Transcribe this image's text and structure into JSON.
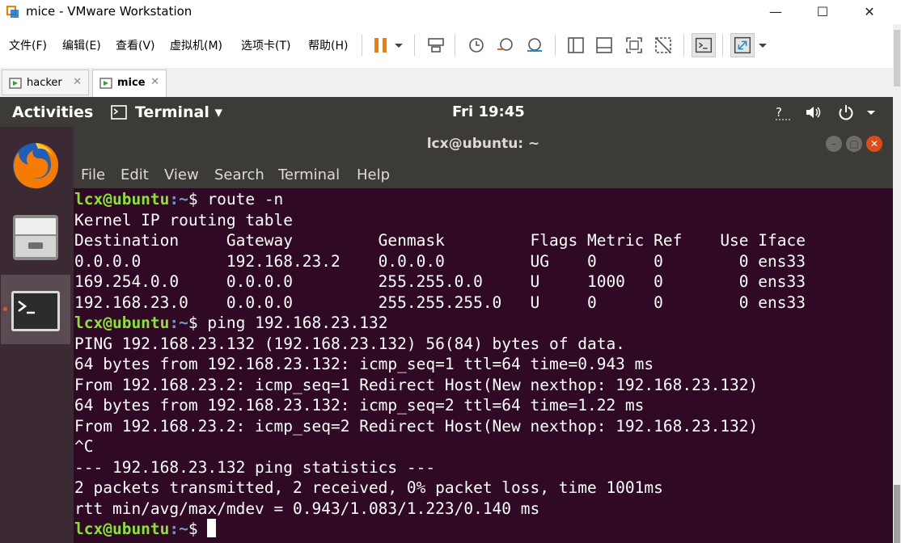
{
  "window": {
    "title": "mice - VMware Workstation"
  },
  "menu": [
    "文件(F)",
    "编辑(E)",
    "查看(V)",
    "虚拟机(M)",
    "选项卡(T)",
    "帮助(H)"
  ],
  "toolbar_icons": [
    "pause-icon",
    "dropdown-icon",
    "send-ctrl-alt-del-icon",
    "snapshot-icon",
    "revert-snapshot-icon",
    "snapshot-manager-icon",
    "show-library-icon",
    "thumbnail-icon",
    "full-screen-icon",
    "unity-icon",
    "console-view-icon",
    "stretch-icon",
    "stretch-dropdown-icon"
  ],
  "vm_tabs": [
    {
      "label": "hacker",
      "active": false
    },
    {
      "label": "mice",
      "active": true
    }
  ],
  "ubuntu": {
    "activities": "Activities",
    "app_menu": "Terminal ▾",
    "clock": "Fri 19:45"
  },
  "dock": [
    "firefox-icon",
    "files-icon",
    "terminal-icon"
  ],
  "terminal": {
    "title": "lcx@ubuntu: ~",
    "menu": [
      "File",
      "Edit",
      "View",
      "Search",
      "Terminal",
      "Help"
    ],
    "prompt_user": "lcx@ubuntu",
    "prompt_path": ":~",
    "prompt_end": "$ ",
    "lines": [
      {
        "prompt": true,
        "text": "route -n"
      },
      {
        "prompt": false,
        "text": "Kernel IP routing table"
      },
      {
        "prompt": false,
        "text": "Destination     Gateway         Genmask         Flags Metric Ref    Use Iface"
      },
      {
        "prompt": false,
        "text": "0.0.0.0         192.168.23.2    0.0.0.0         UG    0      0        0 ens33"
      },
      {
        "prompt": false,
        "text": "169.254.0.0     0.0.0.0         255.255.0.0     U     1000   0        0 ens33"
      },
      {
        "prompt": false,
        "text": "192.168.23.0    0.0.0.0         255.255.255.0   U     0      0        0 ens33"
      },
      {
        "prompt": true,
        "text": "ping 192.168.23.132"
      },
      {
        "prompt": false,
        "text": "PING 192.168.23.132 (192.168.23.132) 56(84) bytes of data."
      },
      {
        "prompt": false,
        "text": "64 bytes from 192.168.23.132: icmp_seq=1 ttl=64 time=0.943 ms"
      },
      {
        "prompt": false,
        "text": "From 192.168.23.2: icmp_seq=1 Redirect Host(New nexthop: 192.168.23.132)"
      },
      {
        "prompt": false,
        "text": "64 bytes from 192.168.23.132: icmp_seq=2 ttl=64 time=1.22 ms"
      },
      {
        "prompt": false,
        "text": "From 192.168.23.2: icmp_seq=2 Redirect Host(New nexthop: 192.168.23.132)"
      },
      {
        "prompt": false,
        "text": "^C"
      },
      {
        "prompt": false,
        "text": "--- 192.168.23.132 ping statistics ---"
      },
      {
        "prompt": false,
        "text": "2 packets transmitted, 2 received, 0% packet loss, time 1001ms"
      },
      {
        "prompt": false,
        "text": "rtt min/avg/max/mdev = 0.943/1.083/1.223/0.140 ms"
      },
      {
        "prompt": true,
        "text": "",
        "cursor": true
      }
    ]
  }
}
